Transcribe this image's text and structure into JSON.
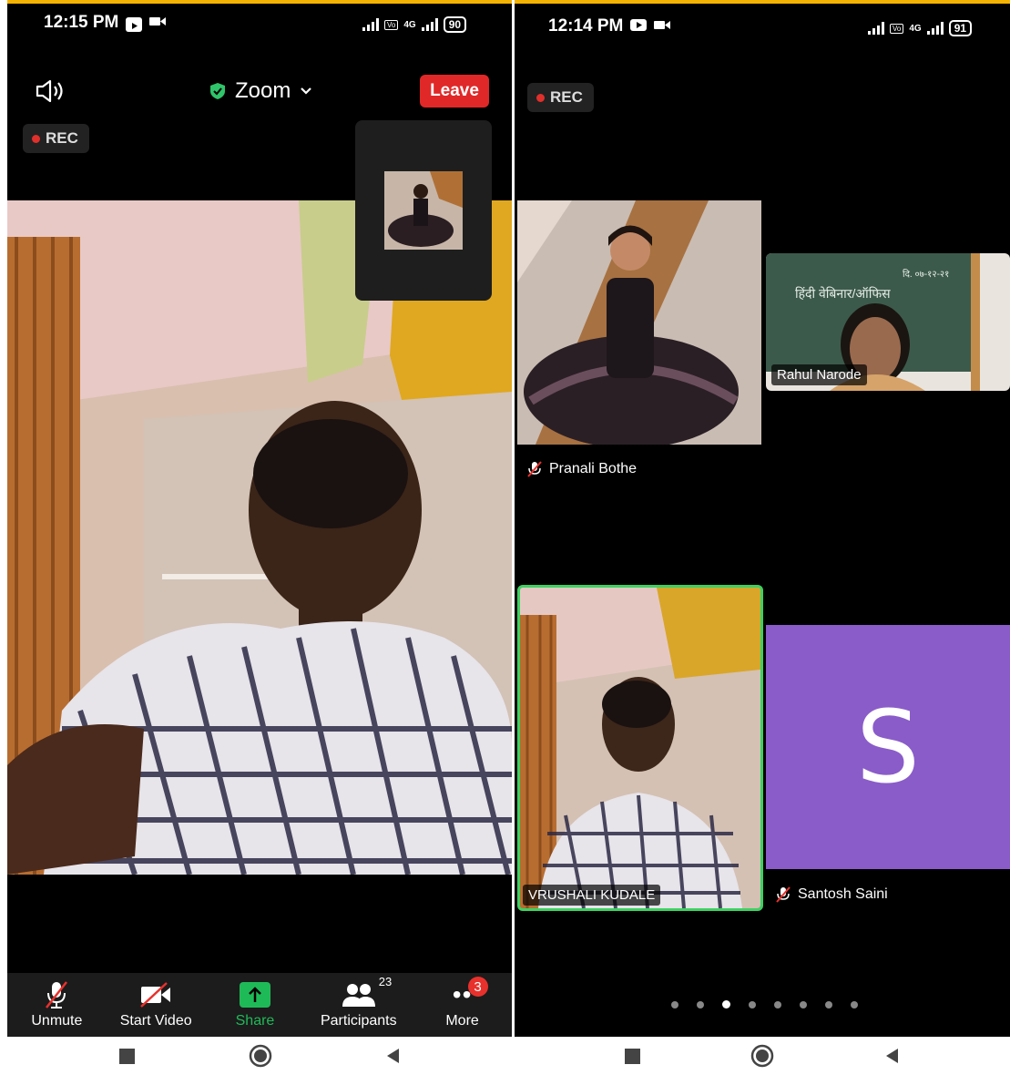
{
  "left": {
    "time": "12:15 PM",
    "battery": "90",
    "network": "4G",
    "rec_label": "REC",
    "meeting_title": "Zoom",
    "leave_label": "Leave",
    "toolbar": {
      "unmute": "Unmute",
      "start_video": "Start Video",
      "share": "Share",
      "participants": "Participants",
      "participants_count": "23",
      "more": "More",
      "more_badge": "3"
    }
  },
  "right": {
    "time": "12:14 PM",
    "battery": "91",
    "network": "4G",
    "rec_label": "REC",
    "tiles": [
      {
        "name": "Pranali Bothe",
        "muted": true
      },
      {
        "name": "Rahul Narode",
        "muted": false
      },
      {
        "name": "VRUSHALI KUDALE",
        "muted": false,
        "active_speaker": true
      },
      {
        "name": "Santosh Saini",
        "muted": true,
        "avatar_letter": "S"
      }
    ],
    "page_count": 8,
    "active_page": 3,
    "chalkboard": {
      "line1": "हिंदी वेबिनार/ऑफिस",
      "line2": "दि. ०७-१२-२१"
    }
  },
  "colors": {
    "leave": "#e02828",
    "share": "#1fba58",
    "active_border": "#3dd161",
    "avatar_bg": "#8a5cc9",
    "badge": "#e8312c"
  }
}
